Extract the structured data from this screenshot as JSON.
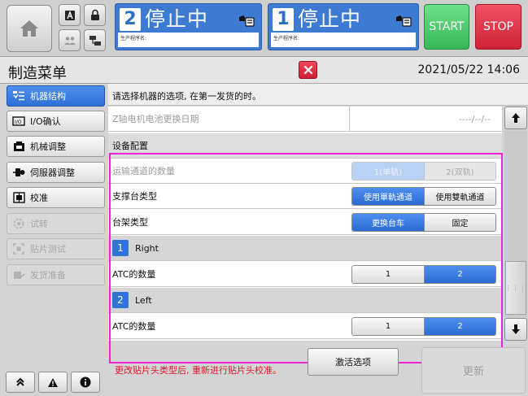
{
  "topbar": {
    "lanes": [
      {
        "number": "2",
        "state": "停止中",
        "program_label": "生产程序名:",
        "program_name": ""
      },
      {
        "number": "1",
        "state": "停止中",
        "program_label": "生产程序名:",
        "program_name": ""
      }
    ],
    "start_label": "START",
    "stop_label": "STOP",
    "colors": {
      "start": "#35b855",
      "stop": "#cf2136",
      "lane_panel": "#3c7bd1"
    }
  },
  "titlebar": {
    "title": "制造菜单",
    "datetime": "2021/05/22 14:06"
  },
  "sidebar": {
    "items": [
      {
        "label": "机器结构",
        "icon": "machine-structure-icon",
        "state": "active"
      },
      {
        "label": "I/O确认",
        "icon": "io-icon",
        "state": "normal"
      },
      {
        "label": "机械调整",
        "icon": "mechanical-adjust-icon",
        "state": "normal"
      },
      {
        "label": "伺服器调整",
        "icon": "servo-icon",
        "state": "normal"
      },
      {
        "label": "校准",
        "icon": "calibration-icon",
        "state": "normal"
      },
      {
        "label": "试转",
        "icon": "trial-run-icon",
        "state": "disabled"
      },
      {
        "label": "贴片测试",
        "icon": "placement-test-icon",
        "state": "disabled"
      },
      {
        "label": "发货准备",
        "icon": "shipping-prep-icon",
        "state": "disabled"
      }
    ]
  },
  "main": {
    "instruction": "请选择机器的选项, 在第一发货的时。",
    "rows": {
      "z_battery_label": "Z轴电机电池更换日期",
      "z_battery_value": "----/--/--",
      "section_title": "设备配置",
      "conveyor_count_label": "运输通道的数量",
      "conveyor_count_options": [
        "1(单轨)",
        "2(双轨)"
      ],
      "support_table_label": "支撑台类型",
      "support_table_options": [
        "使用單軌通道",
        "使用雙軌通道"
      ],
      "cart_type_label": "台架类型",
      "cart_type_options": [
        "更换台车",
        "固定"
      ],
      "lane_right_number": "1",
      "lane_right_name": "Right",
      "atc_right_label": "ATC的数量",
      "atc_right_options": [
        "1",
        "2"
      ],
      "lane_left_number": "2",
      "lane_left_name": "Left",
      "atc_left_label": "ATC的数量",
      "atc_left_options": [
        "1",
        "2"
      ]
    },
    "selected": {
      "conveyor_count": "1(单轨)",
      "support_table": "使用單軌通道",
      "cart_type": "更换台车",
      "atc_right": "2",
      "atc_left": "2"
    },
    "footer_note": "更改贴片头类型后, 重新进行贴片头校准。",
    "activate_label": "激活选项",
    "update_label": "更新"
  }
}
